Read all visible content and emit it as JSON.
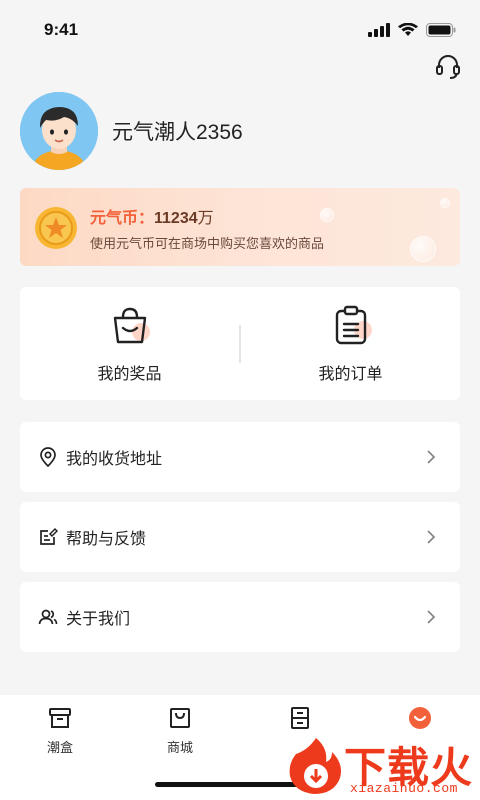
{
  "status_bar": {
    "time": "9:41"
  },
  "profile": {
    "username": "元气潮人2356"
  },
  "coin_card": {
    "label": "元气币：",
    "value": "11234",
    "unit": "万",
    "description": "使用元气币可在商场中购买您喜欢的商品"
  },
  "quick_actions": [
    {
      "label": "我的奖品",
      "icon": "shopping-bag-icon"
    },
    {
      "label": "我的订单",
      "icon": "clipboard-icon"
    }
  ],
  "menu": [
    {
      "label": "我的收货地址",
      "icon": "location-pin-icon"
    },
    {
      "label": "帮助与反馈",
      "icon": "edit-note-icon"
    },
    {
      "label": "关于我们",
      "icon": "users-icon"
    }
  ],
  "tab_bar": {
    "tabs": [
      {
        "label": "潮盒",
        "icon": "box-icon"
      },
      {
        "label": "商城",
        "icon": "shop-bag-icon"
      },
      {
        "label": "",
        "icon": "cabinet-icon"
      },
      {
        "label": "",
        "icon": "smile-icon",
        "active": true
      }
    ]
  },
  "watermark": {
    "text": "下载火",
    "url": "xiazaihuo.com"
  },
  "colors": {
    "accent": "#f2613a",
    "background": "#f5f5f5",
    "card": "#ffffff"
  }
}
